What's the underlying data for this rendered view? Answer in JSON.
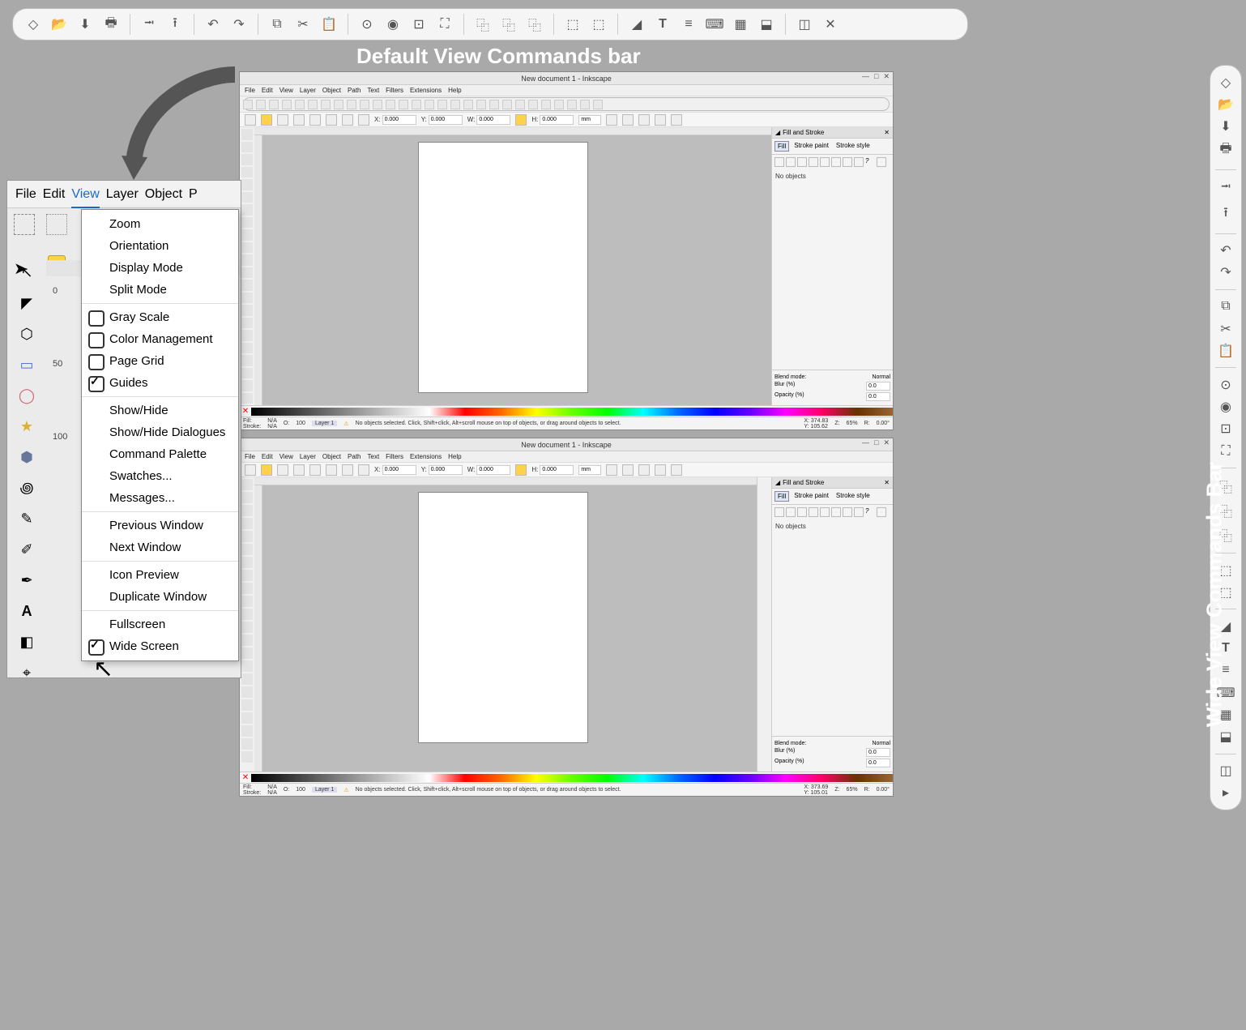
{
  "labels": {
    "default_bar": "Default View Commands bar",
    "wide_bar": "Wide View Commands Bar"
  },
  "inkscape": {
    "title": "New document 1 - Inkscape",
    "menu": [
      "File",
      "Edit",
      "View",
      "Layer",
      "Object",
      "Path",
      "Text",
      "Filters",
      "Extensions",
      "Help"
    ],
    "status_help": "No objects selected. Click, Shift+click, Alt+scroll mouse on top of objects, or drag around objects to select.",
    "fill_label": "Fill:",
    "stroke_label": "Stroke:",
    "fill_value": "N/A",
    "stroke_value": "N/A",
    "opacity_label": "O:",
    "opacity_value": "100",
    "layer_label": "Layer 1",
    "x_label": "X:",
    "y_label": "Y:",
    "coords_top": {
      "x": "374.83",
      "y": "105.62"
    },
    "coords_bot": {
      "x": "373.69",
      "y": "105.01"
    },
    "zoom_label": "Z:",
    "zoom_value": "65%",
    "rotate_label": "R:",
    "rotate_value": "0.00°",
    "ctrl_x": "0.000",
    "ctrl_y": "0.000",
    "ctrl_w": "0.000",
    "ctrl_h": "0.000",
    "unit": "mm",
    "w_label": "W:",
    "h_label": "H:",
    "dock": {
      "panel_title": "Fill and Stroke",
      "tabs": [
        "Fill",
        "Stroke paint",
        "Stroke style"
      ],
      "no_objects": "No objects",
      "blend_label": "Blend mode:",
      "blend_value": "Normal",
      "blur_label": "Blur (%)",
      "blur_value": "0.0",
      "opacity_label": "Opacity (%)",
      "opacity_value": "0.0"
    },
    "snap_x": "0.000",
    "snap_y": "0.000"
  },
  "menucrop": {
    "menubar": [
      "File",
      "Edit",
      "View",
      "Layer",
      "Object",
      "P"
    ],
    "ruler": [
      "0",
      "50",
      "100"
    ]
  },
  "view_menu": {
    "items": [
      {
        "label": "Zoom",
        "check": false
      },
      {
        "label": "Orientation",
        "check": false
      },
      {
        "label": "Display Mode",
        "check": false
      },
      {
        "label": "Split Mode",
        "check": false
      },
      {
        "label": "Gray Scale",
        "check": true,
        "checked": false
      },
      {
        "label": "Color Management",
        "check": true,
        "checked": false
      },
      {
        "label": "Page Grid",
        "check": true,
        "checked": false
      },
      {
        "label": "Guides",
        "check": true,
        "checked": true
      },
      {
        "label": "Show/Hide",
        "check": false
      },
      {
        "label": "Show/Hide Dialogues",
        "check": false
      },
      {
        "label": "Command Palette",
        "check": false
      },
      {
        "label": "Swatches...",
        "check": false
      },
      {
        "label": "Messages...",
        "check": false
      },
      {
        "label": "Previous Window",
        "check": false
      },
      {
        "label": "Next Window",
        "check": false
      },
      {
        "label": "Icon Preview",
        "check": false
      },
      {
        "label": "Duplicate Window",
        "check": false
      },
      {
        "label": "Fullscreen",
        "check": false
      },
      {
        "label": "Wide Screen",
        "check": true,
        "checked": true
      }
    ]
  }
}
